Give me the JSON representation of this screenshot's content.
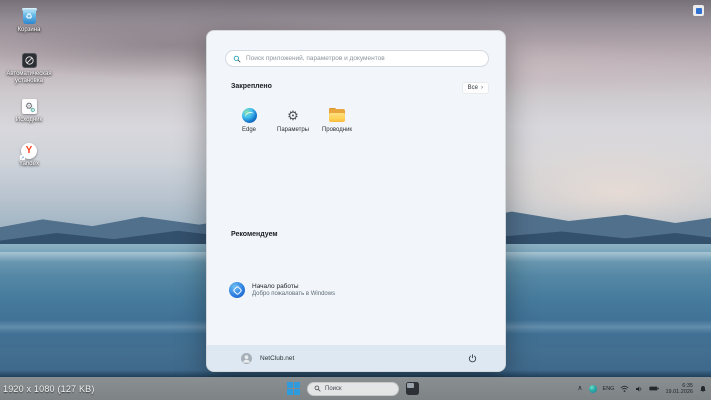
{
  "desktop": {
    "icons": [
      {
        "label": "Корзина"
      },
      {
        "label": "Автоматическая установка"
      },
      {
        "label": "Исходник"
      },
      {
        "label": "Yandex"
      }
    ]
  },
  "start_menu": {
    "search_placeholder": "Поиск приложений, параметров и документов",
    "pinned": {
      "title": "Закреплено",
      "all_button": "Все",
      "all_chevron": "›",
      "apps": [
        {
          "name": "Edge"
        },
        {
          "name": "Параметры"
        },
        {
          "name": "Проводник"
        }
      ]
    },
    "recommended": {
      "title": "Рекомендуем",
      "items": [
        {
          "title": "Начало работы",
          "subtitle": "Добро пожаловать в Windows"
        }
      ]
    },
    "user": {
      "name": "NetClub.net"
    }
  },
  "taskbar": {
    "search_label": "Поиск",
    "tray": {
      "chevron": "∧",
      "language": "ENG",
      "time": "6:35",
      "date": "19.01.2026"
    }
  },
  "viewer_caption": "1920 x 1080 (127 KB)",
  "colors": {
    "accent_blue": "#2f9bdf",
    "menu_background": "#f2f6fa",
    "user_bar": "#dde8f2",
    "taskbar_gray": "#828789",
    "search_icon_teal": "#1aa0b5",
    "yandex_red": "#fc3f1d"
  }
}
